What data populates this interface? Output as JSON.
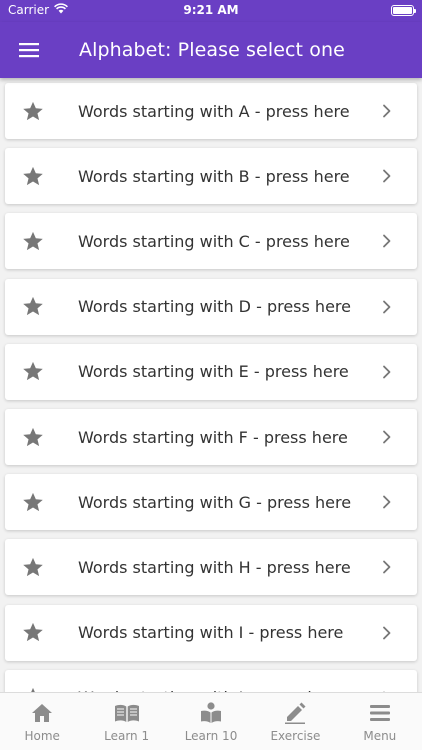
{
  "status_bar": {
    "carrier": "Carrier",
    "time": "9:21 AM"
  },
  "app_bar": {
    "title": "Alphabet: Please select one",
    "menu_icon": "hamburger-menu-icon"
  },
  "list": {
    "items": [
      {
        "label": "Words starting with A - press here"
      },
      {
        "label": "Words starting with B - press here"
      },
      {
        "label": "Words starting with C - press here"
      },
      {
        "label": "Words starting with D - press here"
      },
      {
        "label": "Words starting with E - press here"
      },
      {
        "label": "Words starting with F - press here"
      },
      {
        "label": "Words starting with G - press here"
      },
      {
        "label": "Words starting with H - press here"
      },
      {
        "label": "Words starting with I - press here"
      },
      {
        "label": "Words starting with J - press here"
      }
    ]
  },
  "tab_bar": {
    "tabs": [
      {
        "label": "Home",
        "icon": "home-icon"
      },
      {
        "label": "Learn 1",
        "icon": "book-open-icon"
      },
      {
        "label": "Learn 10",
        "icon": "reader-icon"
      },
      {
        "label": "Exercise",
        "icon": "pencil-icon"
      },
      {
        "label": "Menu",
        "icon": "menu-lines-icon"
      }
    ]
  },
  "colors": {
    "primary": "#6a3fc4",
    "icon_gray": "#8c8c8c",
    "text": "#333333"
  }
}
